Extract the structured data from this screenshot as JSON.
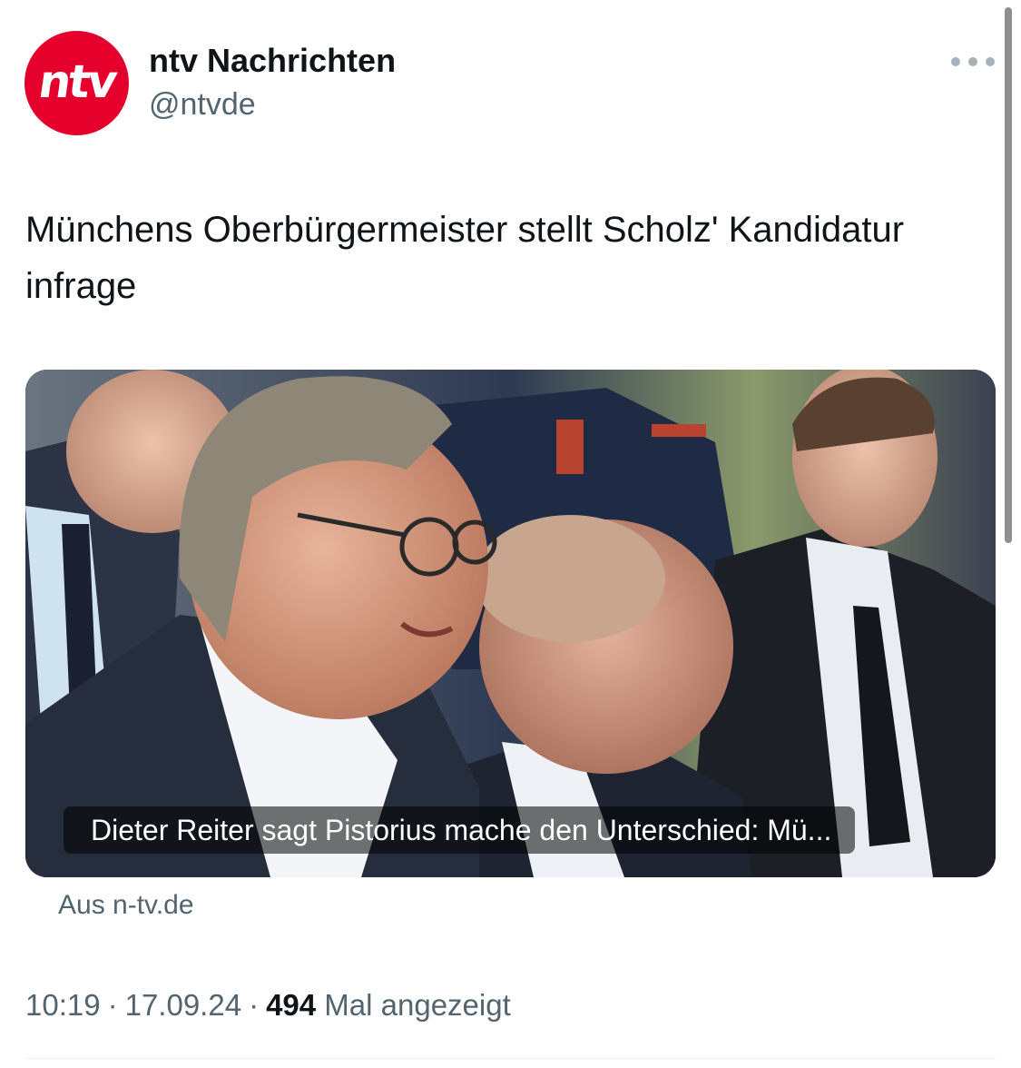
{
  "author": {
    "display_name": "ntv Nachrichten",
    "handle": "@ntvde",
    "avatar_text": "ntv",
    "brand_color": "#e4002b"
  },
  "tweet": {
    "text": "Münchens Oberbürgermeister stellt Scholz' Kandidatur infrage"
  },
  "card": {
    "caption": "Dieter Reiter sagt Pistorius mache den Unterschied: Mü...",
    "source": "Aus n-tv.de",
    "image_description_icon": "news-photo"
  },
  "meta": {
    "time": "10:19",
    "date": "17.09.24",
    "views": "494",
    "views_label": "Mal angezeigt"
  },
  "icons": {
    "more": "more-horizontal-icon"
  },
  "colors": {
    "text_primary": "#0f1419",
    "text_secondary": "#536471"
  }
}
